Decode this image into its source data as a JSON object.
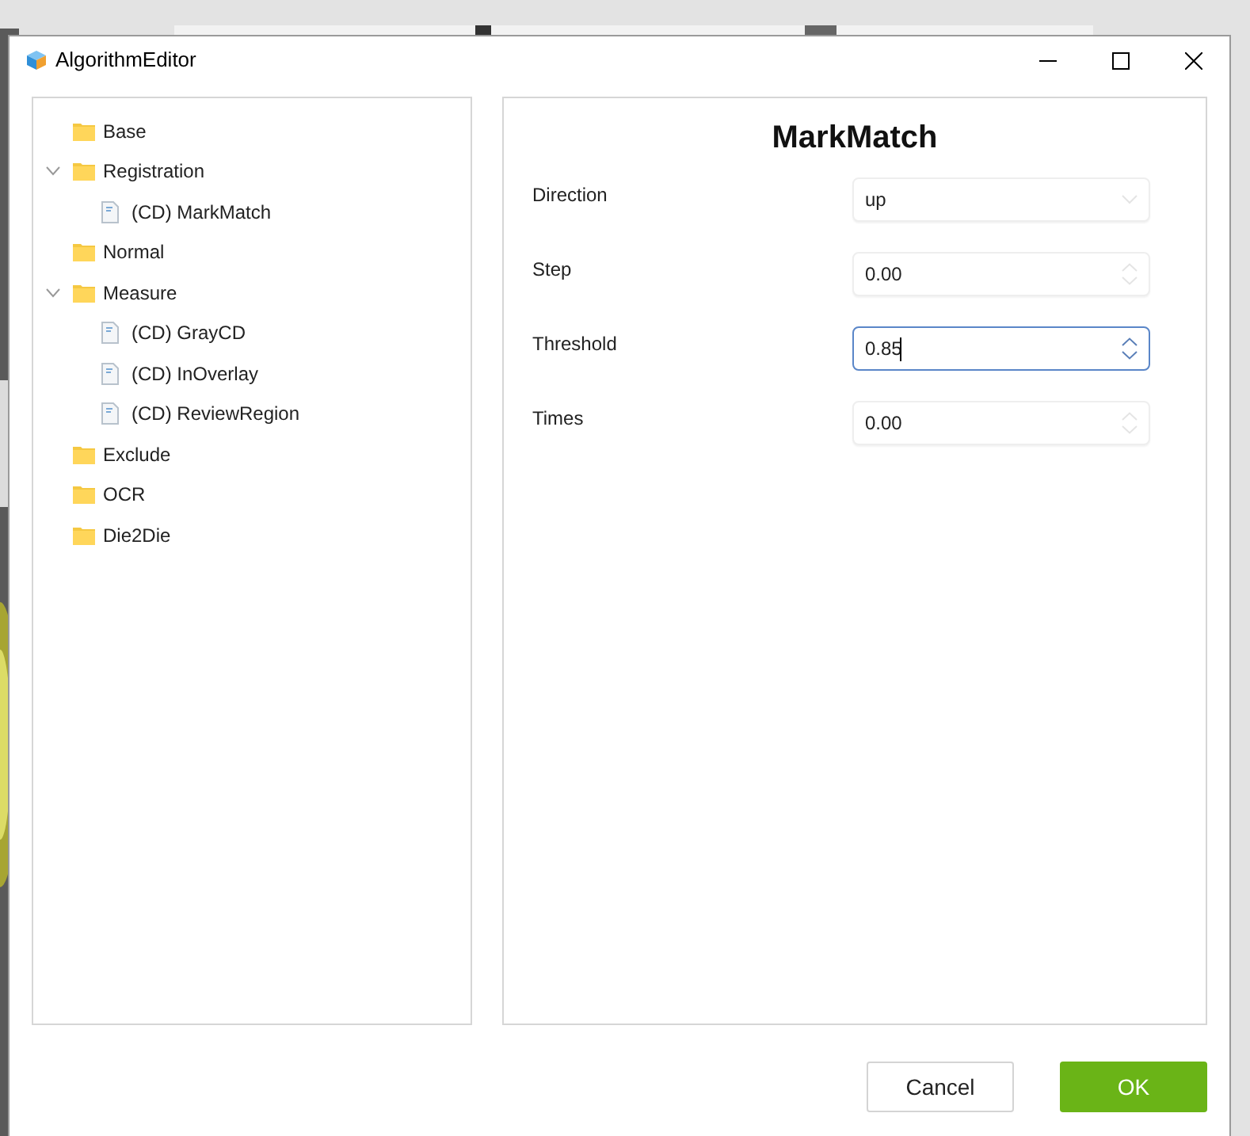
{
  "window": {
    "title": "AlgorithmEditor"
  },
  "tree": [
    {
      "label": "Base",
      "kind": "folder",
      "expanded": false
    },
    {
      "label": "Registration",
      "kind": "folder",
      "expanded": true,
      "children": [
        {
          "label": "(CD) MarkMatch",
          "kind": "file"
        }
      ]
    },
    {
      "label": "Normal",
      "kind": "folder",
      "expanded": false
    },
    {
      "label": "Measure",
      "kind": "folder",
      "expanded": true,
      "children": [
        {
          "label": "(CD) GrayCD",
          "kind": "file"
        },
        {
          "label": "(CD) InOverlay",
          "kind": "file"
        },
        {
          "label": "(CD) ReviewRegion",
          "kind": "file"
        }
      ]
    },
    {
      "label": "Exclude",
      "kind": "folder",
      "expanded": false
    },
    {
      "label": "OCR",
      "kind": "folder",
      "expanded": false
    },
    {
      "label": "Die2Die",
      "kind": "folder",
      "expanded": false
    }
  ],
  "editor": {
    "title": "MarkMatch",
    "fields": [
      {
        "label": "Direction",
        "kind": "dropdown",
        "value": "up",
        "focused": false
      },
      {
        "label": "Step",
        "kind": "spinner",
        "value": "0.00",
        "focused": false
      },
      {
        "label": "Threshold",
        "kind": "spinner",
        "value": "0.85",
        "focused": true
      },
      {
        "label": "Times",
        "kind": "spinner",
        "value": "0.00",
        "focused": false
      }
    ]
  },
  "buttons": [
    {
      "label": "Cancel",
      "kind": "secondary"
    },
    {
      "label": "OK",
      "kind": "primary"
    }
  ]
}
